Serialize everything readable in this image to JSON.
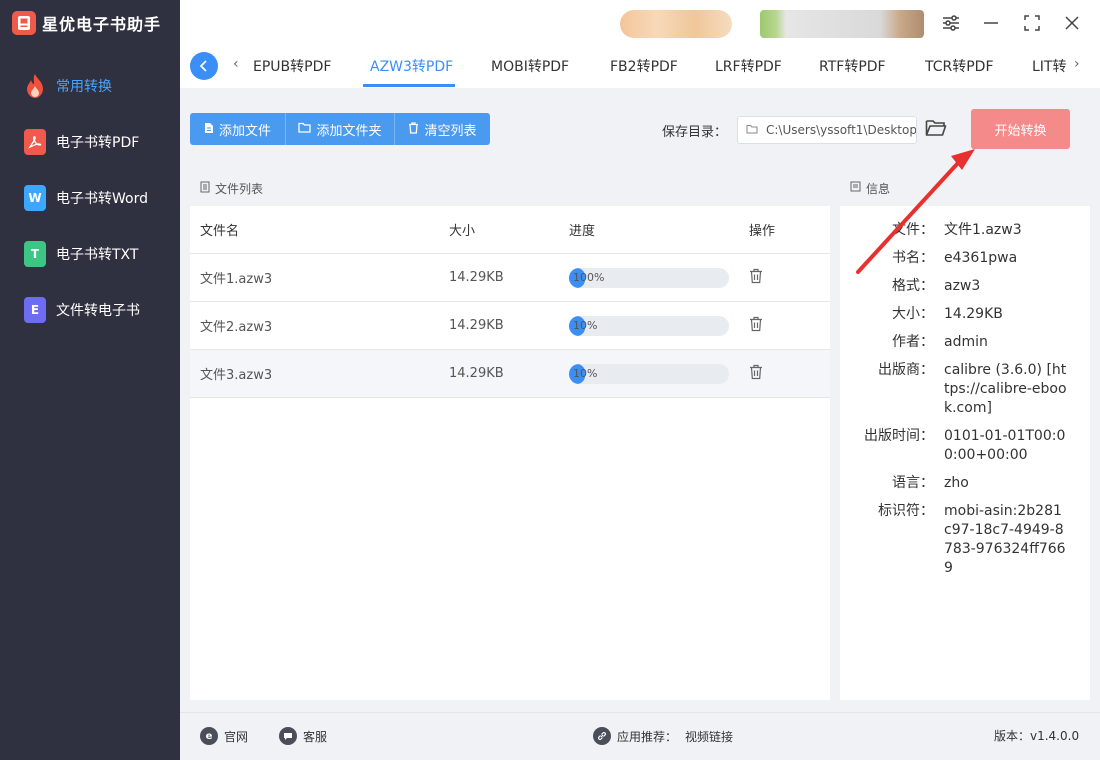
{
  "app": {
    "title": "星优电子书助手"
  },
  "sidebar": {
    "items": [
      {
        "label": "常用转换",
        "icon": "fire-icon",
        "color": "#f0503c",
        "active": true
      },
      {
        "label": "电子书转PDF",
        "icon": "pdf-icon",
        "color": "#f05a4c"
      },
      {
        "label": "电子书转Word",
        "icon": "word-icon",
        "glyph": "W",
        "color": "#3ba7ff"
      },
      {
        "label": "电子书转TXT",
        "icon": "txt-icon",
        "glyph": "T",
        "color": "#3cc583"
      },
      {
        "label": "文件转电子书",
        "icon": "ebook-icon",
        "glyph": "E",
        "color": "#6f6cf4"
      }
    ]
  },
  "tabs": {
    "items": [
      "EPUB转PDF",
      "AZW3转PDF",
      "MOBI转PDF",
      "FB2转PDF",
      "LRF转PDF",
      "RTF转PDF",
      "TCR转PDF",
      "LIT转"
    ],
    "active": "AZW3转PDF"
  },
  "toolbar": {
    "add_file": "添加文件",
    "add_folder": "添加文件夹",
    "clear_list": "清空列表",
    "save_label": "保存目录：",
    "save_path": "C:\\Users\\yssoft1\\Desktop",
    "start": "开始转换"
  },
  "filelist": {
    "title": "文件列表",
    "headers": {
      "name": "文件名",
      "size": "大小",
      "progress": "进度",
      "op": "操作"
    },
    "rows": [
      {
        "name": "文件1.azw3",
        "size": "14.29KB",
        "progress": 100,
        "progress_text": "100%"
      },
      {
        "name": "文件2.azw3",
        "size": "14.29KB",
        "progress": 10,
        "progress_text": "10%"
      },
      {
        "name": "文件3.azw3",
        "size": "14.29KB",
        "progress": 10,
        "progress_text": "10%"
      }
    ]
  },
  "info": {
    "title": "信息",
    "rows": [
      {
        "key": "文件：",
        "value": "文件1.azw3"
      },
      {
        "key": "书名：",
        "value": "e4361pwa"
      },
      {
        "key": "格式：",
        "value": "azw3"
      },
      {
        "key": "大小：",
        "value": "14.29KB"
      },
      {
        "key": "作者：",
        "value": "admin"
      },
      {
        "key": "出版商：",
        "value": "calibre (3.6.0) [https://calibre-ebook.com]"
      },
      {
        "key": "出版时间：",
        "value": "0101-01-01T00:00:00+00:00"
      },
      {
        "key": "语言：",
        "value": "zho"
      },
      {
        "key": "标识符：",
        "value": "mobi-asin:2b281c97-18c7-4949-8783-976324ff7669"
      }
    ]
  },
  "footer": {
    "website": "官网",
    "service": "客服",
    "recommend_label": "应用推荐：",
    "recommend_link": "视频链接",
    "version": "版本：v1.4.0.0"
  },
  "colors": {
    "accent": "#3a8ef5",
    "sidebar": "#2f3140",
    "start_button": "#f48a8a",
    "annotation_arrow": "#e8302f"
  }
}
